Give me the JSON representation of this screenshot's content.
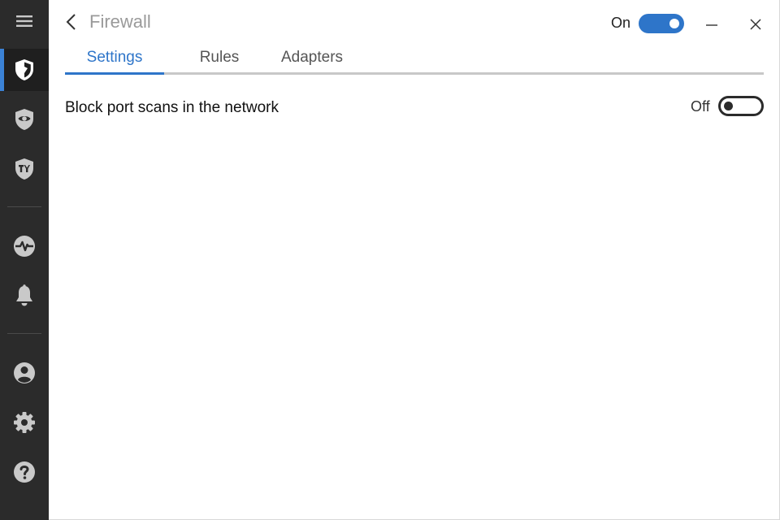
{
  "header": {
    "title": "Firewall",
    "master_state": "On",
    "master_enabled": true
  },
  "tabs": [
    {
      "label": "Settings",
      "active": true
    },
    {
      "label": "Rules",
      "active": false
    },
    {
      "label": "Adapters",
      "active": false
    }
  ],
  "settings": [
    {
      "label": "Block port scans in the network",
      "state": "Off",
      "enabled": false
    }
  ],
  "sidebar": {
    "items": [
      {
        "icon": "hamburger-menu-icon"
      },
      {
        "icon": "shield-icon",
        "active": true
      },
      {
        "icon": "shield-eye-icon"
      },
      {
        "icon": "shield-tools-icon"
      },
      {
        "icon": "activity-pulse-icon"
      },
      {
        "icon": "bell-icon"
      },
      {
        "icon": "user-account-icon"
      },
      {
        "icon": "gear-icon"
      },
      {
        "icon": "help-question-icon"
      }
    ]
  },
  "colors": {
    "accent": "#2e75c9",
    "sidebar_bg": "#2b2b2b",
    "sidebar_icon": "#c9c9c9",
    "title_gray": "#9a9a9a"
  }
}
